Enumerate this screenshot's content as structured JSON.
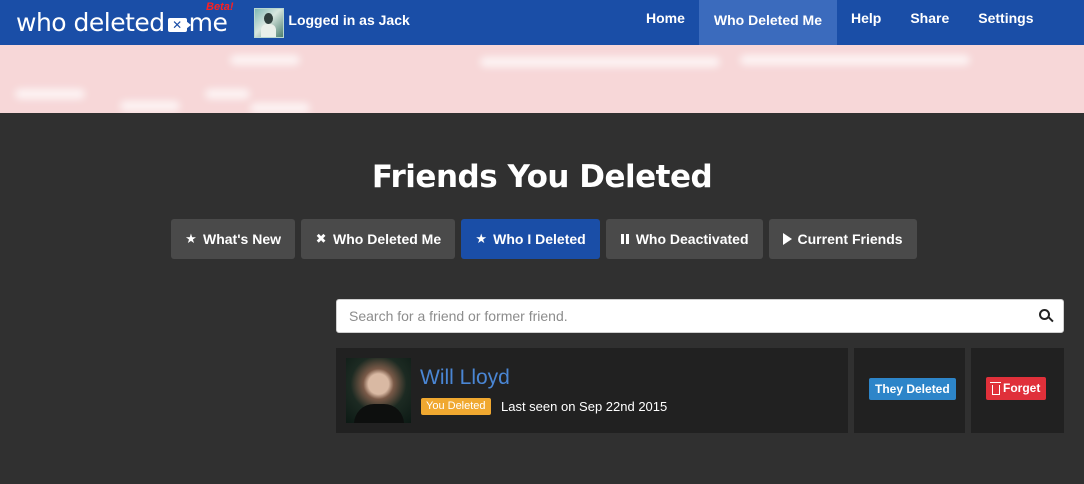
{
  "navbar": {
    "brand_part1": "who deleted",
    "brand_x": "✕",
    "brand_part2": "me",
    "beta": "Beta!",
    "logged_in_prefix": "Logged in as",
    "username": "Jack",
    "links": [
      "Home",
      "Who Deleted Me",
      "Help",
      "Share",
      "Settings"
    ],
    "active_link": "Who Deleted Me"
  },
  "page": {
    "title": "Friends You Deleted"
  },
  "tabs": [
    {
      "label": "What's New",
      "icon": "star-icon"
    },
    {
      "label": "Who Deleted Me",
      "icon": "x-icon"
    },
    {
      "label": "Who I Deleted",
      "icon": "star-icon",
      "active": true
    },
    {
      "label": "Who Deactivated",
      "icon": "pause-icon"
    },
    {
      "label": "Current Friends",
      "icon": "play-icon"
    }
  ],
  "search": {
    "placeholder": "Search for a friend or former friend.",
    "value": ""
  },
  "results": [
    {
      "name": "Will Lloyd",
      "badge": "You Deleted",
      "last_seen": "Last seen on Sep 22nd 2015",
      "status_button": "They Deleted",
      "action_button": "Forget"
    }
  ],
  "colors": {
    "navbar": "#1a4ea7",
    "navbar_active": "#3b6bbd",
    "notice_bg": "#f7d7d8",
    "page_bg": "#303030",
    "tab_bg": "#4a4a4a",
    "tab_active": "#1a4ea7",
    "row_bg": "#212121",
    "friend_name": "#4a86d4",
    "badge_orange": "#f0a830",
    "button_blue": "#2d85c9",
    "button_red": "#e0303a"
  }
}
